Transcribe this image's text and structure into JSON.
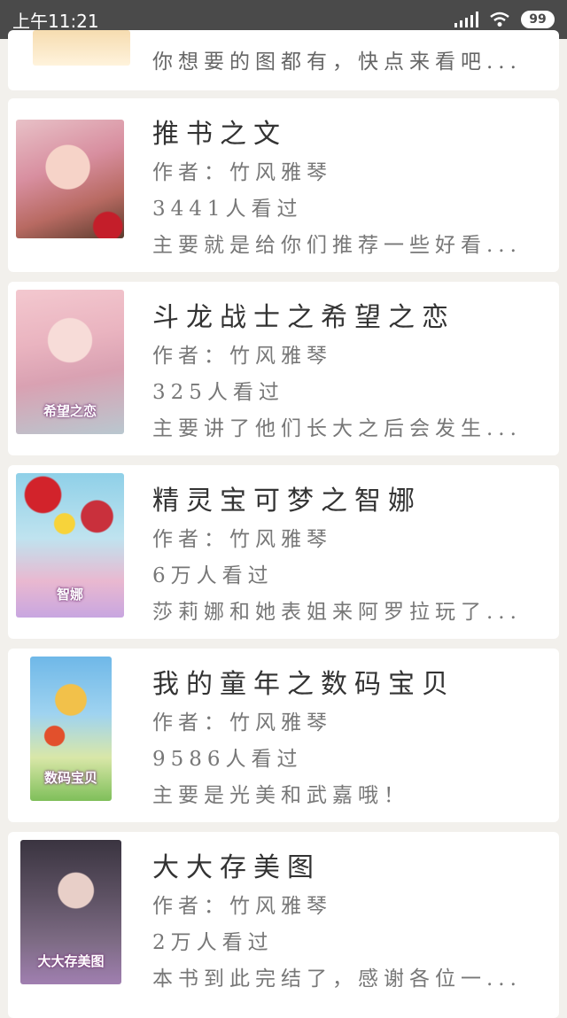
{
  "status_bar": {
    "time": "上午11:21",
    "battery": "99"
  },
  "top_card": {
    "desc": "你想要的图都有，快点来看吧..."
  },
  "books": [
    {
      "title": "推书之文",
      "author": "作者：竹风雅琴",
      "views": "3441人看过",
      "desc": "主要就是给你们推荐一些好看...",
      "cover_text": ""
    },
    {
      "title": "斗龙战士之希望之恋",
      "author": "作者：竹风雅琴",
      "views": "325人看过",
      "desc": "主要讲了他们长大之后会发生...",
      "cover_text": "希望之恋"
    },
    {
      "title": "精灵宝可梦之智娜",
      "author": "作者：竹风雅琴",
      "views": "6万人看过",
      "desc": "莎莉娜和她表姐来阿罗拉玩了...",
      "cover_text": "智娜"
    },
    {
      "title": "我的童年之数码宝贝",
      "author": "作者：竹风雅琴",
      "views": "9586人看过",
      "desc": "主要是光美和武嘉哦！",
      "cover_text": "数码宝贝"
    },
    {
      "title": "大大存美图",
      "author": "作者：竹风雅琴",
      "views": "2万人看过",
      "desc": "本书到此完结了，感谢各位一...",
      "cover_text": "大大存美图"
    }
  ]
}
